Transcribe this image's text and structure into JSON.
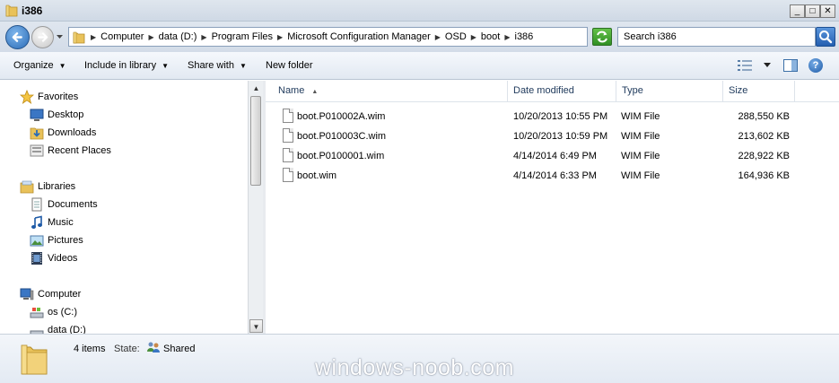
{
  "window": {
    "title": "i386",
    "minimize_label": "_",
    "maximize_label": "□",
    "close_label": "✕"
  },
  "address": {
    "crumbs": [
      "Computer",
      "data (D:)",
      "Program Files",
      "Microsoft Configuration Manager",
      "OSD",
      "boot",
      "i386"
    ]
  },
  "search": {
    "placeholder": "Search i386"
  },
  "commands": {
    "organize": "Organize",
    "include_in_library": "Include in library",
    "share_with": "Share with",
    "new_folder": "New folder",
    "help": "?"
  },
  "nav": {
    "favorites": {
      "label": "Favorites",
      "icon": "star-icon"
    },
    "favorites_items": [
      {
        "label": "Desktop",
        "icon": "desktop-icon"
      },
      {
        "label": "Downloads",
        "icon": "downloads-icon"
      },
      {
        "label": "Recent Places",
        "icon": "recent-places-icon"
      }
    ],
    "libraries": {
      "label": "Libraries",
      "icon": "libraries-icon"
    },
    "libraries_items": [
      {
        "label": "Documents",
        "icon": "documents-icon"
      },
      {
        "label": "Music",
        "icon": "music-icon"
      },
      {
        "label": "Pictures",
        "icon": "pictures-icon"
      },
      {
        "label": "Videos",
        "icon": "videos-icon"
      }
    ],
    "computer": {
      "label": "Computer",
      "icon": "computer-icon"
    },
    "computer_items": [
      {
        "label": "os (C:)",
        "icon": "drive-icon"
      },
      {
        "label": "data (D:)",
        "icon": "drive-icon"
      }
    ]
  },
  "columns": {
    "name": "Name",
    "date": "Date modified",
    "type": "Type",
    "size": "Size"
  },
  "files": [
    {
      "name": "boot.P010002A.wim",
      "date": "10/20/2013 10:55 PM",
      "type": "WIM File",
      "size": "288,550 KB"
    },
    {
      "name": "boot.P010003C.wim",
      "date": "10/20/2013 10:59 PM",
      "type": "WIM File",
      "size": "213,602 KB"
    },
    {
      "name": "boot.P0100001.wim",
      "date": "4/14/2014 6:49 PM",
      "type": "WIM File",
      "size": "228,922 KB"
    },
    {
      "name": "boot.wim",
      "date": "4/14/2014 6:33 PM",
      "type": "WIM File",
      "size": "164,936 KB"
    }
  ],
  "details": {
    "count": "4 items",
    "state_label": "State:",
    "state_value": "Shared"
  },
  "watermark": "windows-noob.com",
  "colors": {
    "accent": "#2a6cb7",
    "header_text": "#1e395b",
    "folder": "#e9c25a"
  }
}
